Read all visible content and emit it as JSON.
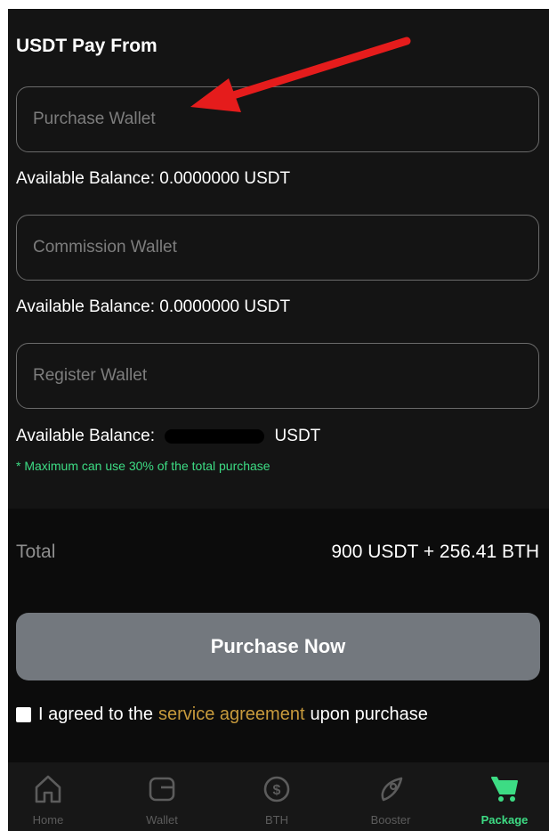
{
  "pay_from": {
    "title": "USDT Pay From",
    "wallets": [
      {
        "placeholder": "Purchase Wallet",
        "balance_label": "Available Balance:",
        "balance": "0.0000000",
        "unit": "USDT"
      },
      {
        "placeholder": "Commission Wallet",
        "balance_label": "Available Balance:",
        "balance": "0.0000000",
        "unit": "USDT"
      },
      {
        "placeholder": "Register Wallet",
        "balance_label": "Available Balance:",
        "unit": "USDT"
      }
    ],
    "note": "* Maximum can use 30% of the total purchase"
  },
  "summary": {
    "total_label": "Total",
    "total_value": "900 USDT + 256.41 BTH"
  },
  "actions": {
    "purchase_label": "Purchase Now",
    "agreement": {
      "prefix": "I agreed to the",
      "link": "service agreement",
      "suffix": "upon purchase",
      "checked": false
    }
  },
  "nav": {
    "items": [
      {
        "label": "Home",
        "icon": "home-icon"
      },
      {
        "label": "Wallet",
        "icon": "wallet-icon"
      },
      {
        "label": "BTH",
        "icon": "dollar-coin-icon"
      },
      {
        "label": "Booster",
        "icon": "rocket-icon"
      },
      {
        "label": "Package",
        "icon": "cart-icon"
      }
    ],
    "active": "Package"
  },
  "colors": {
    "background": "#0c0c0c",
    "accent_green": "#3ddc84",
    "link_gold": "#c79a3c",
    "button_gray": "#73787e",
    "annotation_red": "#e51c1c"
  }
}
